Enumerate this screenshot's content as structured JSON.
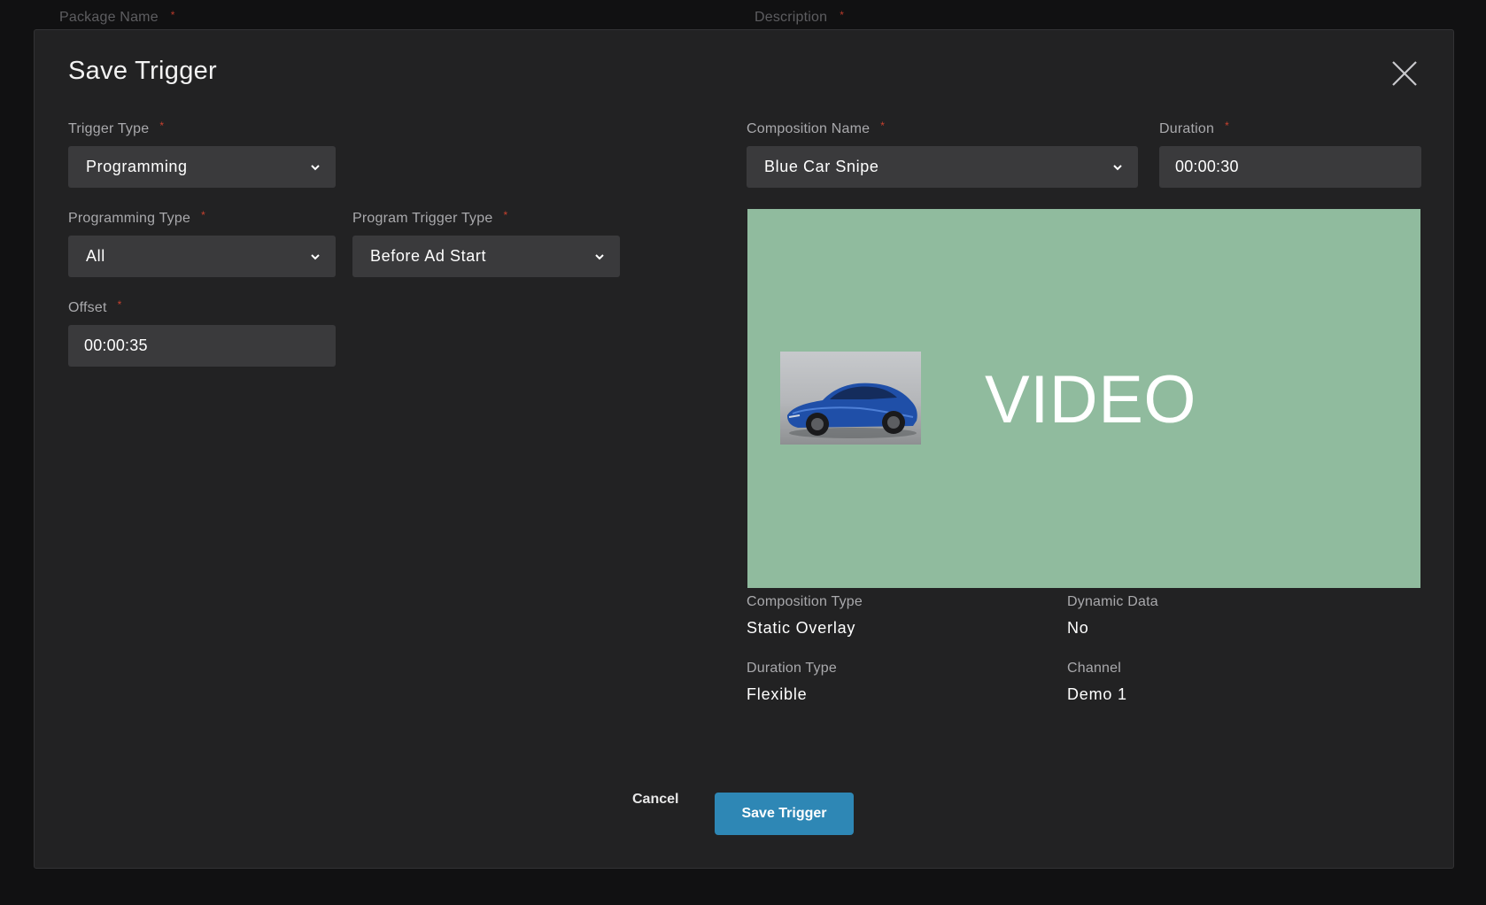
{
  "background": {
    "package_name_label": "Package Name",
    "description_label": "Description",
    "required_marker": "*"
  },
  "modal": {
    "title": "Save Trigger",
    "required_marker": "*",
    "trigger_type": {
      "label": "Trigger Type",
      "value": "Programming"
    },
    "programming_type": {
      "label": "Programming Type",
      "value": "All"
    },
    "program_trigger_type": {
      "label": "Program Trigger Type",
      "value": "Before Ad Start"
    },
    "offset": {
      "label": "Offset",
      "value": "00:00:35"
    },
    "composition_name": {
      "label": "Composition Name",
      "value": "Blue Car Snipe"
    },
    "duration": {
      "label": "Duration",
      "value": "00:00:30"
    },
    "preview": {
      "text": "VIDEO",
      "background_color": "#90bb9e"
    },
    "details": {
      "composition_type": {
        "label": "Composition Type",
        "value": "Static Overlay"
      },
      "dynamic_data": {
        "label": "Dynamic Data",
        "value": "No"
      },
      "duration_type": {
        "label": "Duration Type",
        "value": "Flexible"
      },
      "channel": {
        "label": "Channel",
        "value": "Demo 1"
      }
    },
    "buttons": {
      "cancel": "Cancel",
      "save": "Save Trigger"
    }
  },
  "colors": {
    "page_background": "#111112",
    "modal_background": "#222223",
    "field_background": "#3a3a3c",
    "primary_button": "#2e87b5",
    "required_marker": "#c8412e"
  },
  "icons": {
    "close": "close-icon",
    "dropdown": "chevron-down-icon",
    "thumbnail": "blue-sports-car-image"
  }
}
